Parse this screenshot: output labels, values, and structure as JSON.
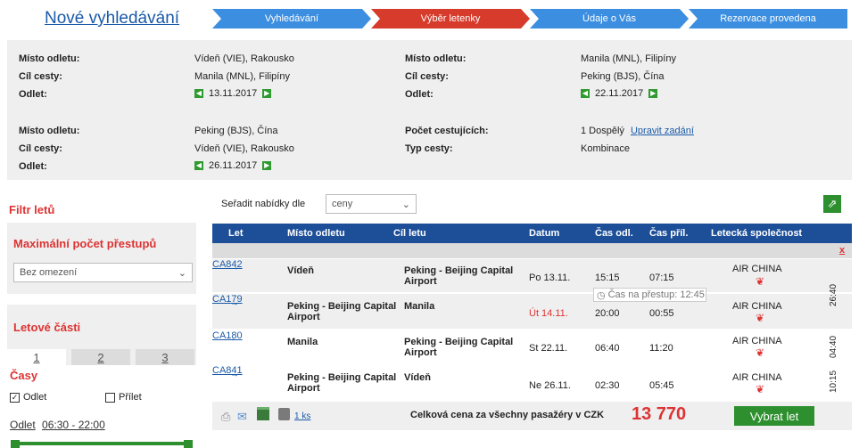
{
  "header": {
    "new_search": "Nové vyhledávání",
    "steps": [
      "Vyhledávání",
      "Výběr letenky",
      "Údaje o Vás",
      "Rezervace provedena"
    ],
    "active_step": 1
  },
  "colors": {
    "step_blue": "#3c8ee0",
    "step_active": "#d63b2b",
    "header_blue": "#1d4f99",
    "green": "#2d8f2d",
    "red": "#d33333"
  },
  "search_info": {
    "leg1": {
      "from_label": "Místo odletu:",
      "from": "Vídeň (VIE), Rakousko",
      "to_label": "Cíl cesty:",
      "to": "Manila (MNL), Filipíny",
      "date_label": "Odlet:",
      "date": "13.11.2017"
    },
    "leg2": {
      "from_label": "Místo odletu:",
      "from": "Manila (MNL), Filipíny",
      "to_label": "Cíl cesty:",
      "to": "Peking (BJS), Čína",
      "date_label": "Odlet:",
      "date": "22.11.2017"
    },
    "leg3": {
      "from_label": "Místo odletu:",
      "from": "Peking (BJS), Čína",
      "to_label": "Cíl cesty:",
      "to": "Vídeň (VIE), Rakousko",
      "date_label": "Odlet:",
      "date": "26.11.2017"
    },
    "passengers_label": "Počet cestujících:",
    "passengers": "1 Dospělý",
    "edit_link": "Upravit zadání",
    "trip_type_label": "Typ cesty:",
    "trip_type": "Kombinace"
  },
  "filter": {
    "title": "Filtr letů",
    "max_stops_title": "Maximální počet přestupů",
    "max_stops_value": "Bez omezení",
    "segments_title": "Letové části",
    "tabs": [
      "1",
      "2",
      "3"
    ],
    "times_title": "Časy",
    "departure_check": "Odlet",
    "arrival_check": "Přílet",
    "departure_range_label": "Odlet",
    "departure_range": "06:30 - 22:00"
  },
  "sort": {
    "label": "Seřadit nabídky dle",
    "value": "ceny"
  },
  "table": {
    "headers": [
      "Let",
      "Místo odletu",
      "Cíl letu",
      "Datum",
      "Čas odl.",
      "Čas příl.",
      "Letecká společnost"
    ],
    "close_label": "x",
    "rows": [
      {
        "flight": "CA842",
        "dir": "→",
        "from": "Vídeň",
        "to": "Peking - Beijing Capital Airport",
        "date": "Po 13.11.",
        "dep": "15:15",
        "arr": "07:15",
        "airline": "AIR CHINA"
      },
      {
        "flight": "CA179",
        "dir": "→",
        "from": "Peking - Beijing Capital Airport",
        "to": "Manila",
        "date": "Út 14.11.",
        "dep": "20:00",
        "arr": "00:55",
        "airline": "AIR CHINA"
      },
      {
        "flight": "CA180",
        "dir": "←",
        "from": "Manila",
        "to": "Peking - Beijing Capital Airport",
        "date": "St 22.11.",
        "dep": "06:40",
        "arr": "11:20",
        "airline": "AIR CHINA"
      },
      {
        "flight": "CA841",
        "dir": "→",
        "from": "Peking - Beijing Capital Airport",
        "to": "Vídeň",
        "date": "Ne 26.11.",
        "dep": "02:30",
        "arr": "05:45",
        "airline": "AIR CHINA"
      }
    ],
    "transfer_note": "Čas na přestup: 12:45",
    "durations": [
      "26:40",
      "04:40",
      "10:15"
    ]
  },
  "totals": {
    "pieces": "1 ks",
    "label": "Celková cena za všechny pasažéry v CZK",
    "price": "13 770",
    "button": "Vybrat let"
  }
}
